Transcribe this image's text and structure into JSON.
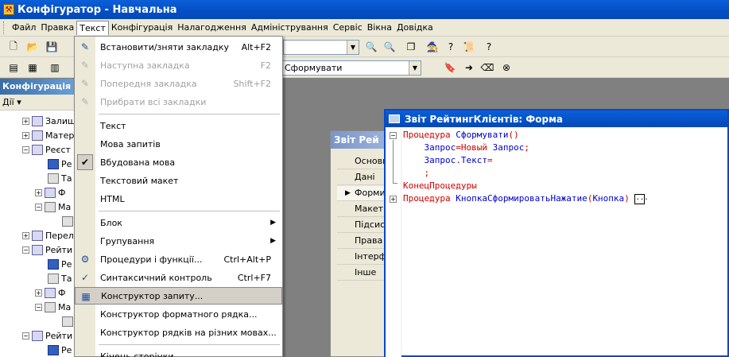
{
  "window": {
    "title": "Конфігуратор - Навчальна",
    "app_icon": "config-app-icon"
  },
  "menubar": {
    "items": [
      {
        "label": "Файл",
        "key": "Ф"
      },
      {
        "label": "Правка",
        "key": "П"
      },
      {
        "label": "Текст",
        "key": "Т",
        "active": true
      },
      {
        "label": "Конфігурація",
        "key": "К"
      },
      {
        "label": "Налагодження",
        "key": "Н"
      },
      {
        "label": "Адміністрування",
        "key": "А"
      },
      {
        "label": "Сервіс",
        "key": "С"
      },
      {
        "label": "Вікна",
        "key": "В"
      },
      {
        "label": "Довідка",
        "key": "Д"
      }
    ]
  },
  "toolbar": {
    "procedure_combo_value": "Сформувати"
  },
  "left_panel": {
    "title": "Конфігурація *",
    "actions_label": "Дії ▾",
    "tree": [
      "Залиш",
      "Матер",
      "Реєст",
      "Ре",
      "Та",
      "Ф",
      "Ма",
      "",
      "Перел",
      "Рейти",
      "Ре",
      "Та",
      "Ф",
      "Ма",
      "",
      "Рейти",
      "Ре",
      "Та"
    ]
  },
  "text_menu": {
    "items": [
      {
        "label": "Встановити/зняти закладку",
        "shortcut": "Alt+F2",
        "enabled": true,
        "icon": "bookmark-toggle-icon"
      },
      {
        "label": "Наступна закладка",
        "shortcut": "F2",
        "enabled": false,
        "icon": "bookmark-next-icon"
      },
      {
        "label": "Попередня закладка",
        "shortcut": "Shift+F2",
        "enabled": false,
        "icon": "bookmark-prev-icon"
      },
      {
        "label": "Прибрати всі закладки",
        "shortcut": "",
        "enabled": false,
        "icon": "bookmark-clear-icon"
      },
      {
        "sep": true
      },
      {
        "label": "Текст",
        "shortcut": "",
        "enabled": true
      },
      {
        "label": "Мова запитів",
        "shortcut": "",
        "enabled": true
      },
      {
        "label": "Вбудована мова",
        "shortcut": "",
        "enabled": true,
        "checked": true
      },
      {
        "label": "Текстовий макет",
        "shortcut": "",
        "enabled": true
      },
      {
        "label": "HTML",
        "shortcut": "",
        "enabled": true
      },
      {
        "sep": true
      },
      {
        "label": "Блок",
        "shortcut": "",
        "enabled": true,
        "submenu": true
      },
      {
        "label": "Групування",
        "shortcut": "",
        "enabled": true,
        "submenu": true
      },
      {
        "label": "Процедури і функції...",
        "shortcut": "Ctrl+Alt+P",
        "enabled": true,
        "icon": "procedures-icon"
      },
      {
        "label": "Синтаксичний контроль",
        "shortcut": "Ctrl+F7",
        "enabled": true,
        "icon": "syntax-check-icon"
      },
      {
        "label": "Конструктор запиту...",
        "shortcut": "",
        "enabled": true,
        "hover": true,
        "icon": "query-builder-icon"
      },
      {
        "label": "Конструктор форматного рядка...",
        "shortcut": "",
        "enabled": true
      },
      {
        "label": "Конструктор рядків на різних мовах...",
        "shortcut": "",
        "enabled": true
      },
      {
        "sep": true
      },
      {
        "label": "Кінець сторінки",
        "shortcut": "",
        "enabled": true
      }
    ]
  },
  "back_window": {
    "title": "Звіт Рей",
    "tabs": [
      "Основн",
      "Дані",
      "Форми",
      "Макети",
      "Підсист",
      "Права",
      "Інтерф",
      "Інше"
    ],
    "selected_tab": 2
  },
  "form_window": {
    "title": "Звіт РейтингКлієнтів: Форма",
    "code": [
      {
        "parts": [
          [
            "kw",
            "Процедура "
          ],
          [
            "id",
            "Сформувати"
          ],
          [
            "kw",
            "()"
          ]
        ]
      },
      {
        "parts": [
          [
            "id",
            "    Запрос"
          ],
          [
            "kw",
            "="
          ],
          [
            "kw",
            "Новый "
          ],
          [
            "id",
            "Запрос"
          ],
          [
            "kw",
            ";"
          ]
        ]
      },
      {
        "parts": [
          [
            "id",
            "    Запрос"
          ],
          [
            "kw",
            "."
          ],
          [
            "id",
            "Текст"
          ],
          [
            "kw",
            "="
          ]
        ]
      },
      {
        "parts": [
          [
            "kw",
            "    ;"
          ]
        ]
      },
      {
        "parts": [
          [
            "kw",
            "КонецПроцедуры"
          ]
        ]
      },
      {
        "parts": [
          [
            "kw",
            "Процедура "
          ],
          [
            "id",
            "КнопкаСформироватьНажатие"
          ],
          [
            "kw",
            "("
          ],
          [
            "id",
            "Кнопка"
          ],
          [
            "kw",
            ")"
          ]
        ]
      }
    ],
    "collapsed_marker": "..."
  }
}
